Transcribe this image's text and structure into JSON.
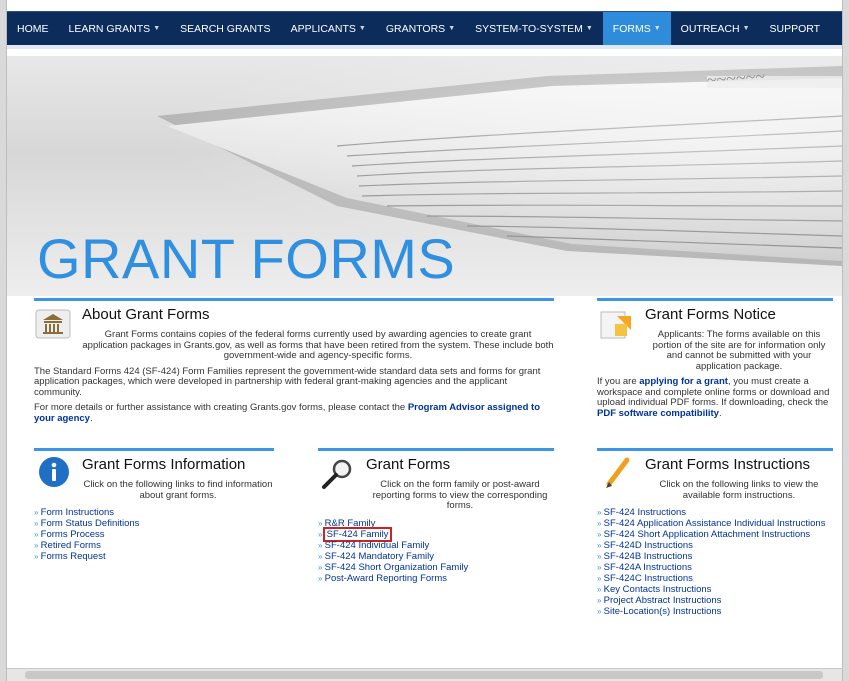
{
  "nav": {
    "items": [
      {
        "label": "HOME",
        "has_caret": false,
        "active": false
      },
      {
        "label": "LEARN GRANTS",
        "has_caret": true,
        "active": false
      },
      {
        "label": "SEARCH GRANTS",
        "has_caret": false,
        "active": false
      },
      {
        "label": "APPLICANTS",
        "has_caret": true,
        "active": false
      },
      {
        "label": "GRANTORS",
        "has_caret": true,
        "active": false
      },
      {
        "label": "SYSTEM-TO-SYSTEM",
        "has_caret": true,
        "active": false
      },
      {
        "label": "FORMS",
        "has_caret": true,
        "active": true
      },
      {
        "label": "OUTREACH",
        "has_caret": true,
        "active": false
      },
      {
        "label": "SUPPORT",
        "has_caret": false,
        "active": false
      }
    ],
    "caret_glyph": "▼",
    "bar_color": "#0c2d5c",
    "active_color": "#2f8cdb"
  },
  "hero": {
    "title": "GRANT FORMS",
    "title_color": "#2f8fe0"
  },
  "about": {
    "title": "About Grant Forms",
    "p1": "Grant Forms contains copies of the federal forms currently used by awarding agencies to create grant application packages in Grants.gov, as well as forms that have been retired from the system. These include both government-wide and agency-specific forms.",
    "p2": "The Standard Forms 424 (SF-424) Form Families represent the government-wide standard data sets and forms for grant application packages, which were developed in partnership with federal grant-making agencies and the applicant community.",
    "p3_prefix": "For more details or further assistance with creating Grants.gov forms, please contact the ",
    "p3_link": "Program Advisor assigned to your agency",
    "p3_suffix": "."
  },
  "notice": {
    "title": "Grant Forms Notice",
    "p1": "Applicants: The forms available on this portion of the site are for information only and cannot be submitted with your application package.",
    "p2_prefix": "If you are ",
    "p2_link1": "applying for a grant",
    "p2_mid": ", you must create a workspace and complete online forms or download and upload individual PDF forms. If downloading, check the ",
    "p2_link2": "PDF software compatibility",
    "p2_suffix": "."
  },
  "info": {
    "title": "Grant Forms Information",
    "desc": "Click on the following links to find information about grant forms.",
    "links": [
      "Form Instructions",
      "Form Status Definitions",
      "Forms Process",
      "Retired Forms",
      "Forms Request"
    ]
  },
  "forms": {
    "title": "Grant Forms",
    "desc": "Click on the form family or post-award reporting forms to view the corresponding forms.",
    "links": [
      "R&R Family",
      "SF-424 Family",
      "SF-424 Individual Family",
      "SF-424 Mandatory Family",
      "SF-424 Short Organization Family",
      "Post-Award Reporting Forms"
    ],
    "highlight_color": "#cc2222"
  },
  "instructions": {
    "title": "Grant Forms Instructions",
    "desc": "Click on the following links to view the available form instructions.",
    "links": [
      "SF-424 Instructions",
      "SF-424 Application Assistance Individual Instructions",
      "SF-424 Short Application Attachment Instructions",
      "SF-424D Instructions",
      "SF-424B Instructions",
      "SF-424A Instructions",
      "SF-424C Instructions",
      "Key Contacts Instructions",
      "Project Abstract Instructions",
      "Site-Location(s) Instructions"
    ]
  }
}
